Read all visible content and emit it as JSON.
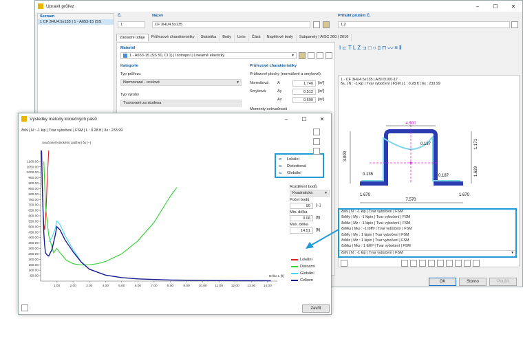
{
  "main_window": {
    "title": "Upravit průřez",
    "controls": [
      "–",
      "☐",
      "✕"
    ]
  },
  "list": {
    "header": "Seznam",
    "item": "1  CF 3HU4.5x135 | 1 - A653-15 (SS"
  },
  "fields": {
    "no_label": "Č.",
    "no_value": "1",
    "name_label": "Název",
    "name_value": "CF 3HU4.5x135",
    "assign_label": "Přiřadit prutům Č.",
    "assign_value": "1,2"
  },
  "tabs": [
    "Základní údaje",
    "Průřezové charakteristiky",
    "Statistika",
    "Body",
    "Linie",
    "Části",
    "Napěťové body",
    "Subpanely | AISC 360 | 2016"
  ],
  "material": {
    "label": "Materiál",
    "value": "1 - A653-15 (SS 50, Cl 1) | Izotropní | Lineárně elastický"
  },
  "category": {
    "label": "Kategorie",
    "type_label": "Typ průřezu",
    "type_value": "Normované - ocelové",
    "manuf_label": "Typ výroby",
    "manuf_value": "Tvarované za studena"
  },
  "props": {
    "label": "Průřezové charakteristiky",
    "subtitle": "Průřezové plochy (normálové a smykové)",
    "rows": [
      {
        "name": "Normálová",
        "sym": "A",
        "val": "1.740",
        "unit": "[in²]"
      },
      {
        "name": "Smyková",
        "sym": "Ay",
        "val": "0.512",
        "unit": "[in²]"
      },
      {
        "name": "",
        "sym": "Az",
        "val": "0.609",
        "unit": "[in²]"
      }
    ],
    "more": "Momenty setrvačnosti"
  },
  "preview": {
    "line1": "1 - CF 3HU4.5x135 | AISI D100-17",
    "line2": "δs,  | N : -1 kip | Tvar vybočení | FSM | L : 0.28 ft | δs : 233.99",
    "dims": {
      "top": "4.500",
      "height": "3.000",
      "right1": "1.171",
      "right2": "1.629",
      "lflange": "1.670",
      "rflange": "1.670",
      "bottom": "7.570",
      "d1": "0.137",
      "d2": "0.135",
      "d3": "0.187"
    }
  },
  "cases": {
    "items": [
      "δsN | N : -1 kip | Tvar vybočení | FSM",
      "δsMy | My : -1 kipin | Tvar vybočení | FSM",
      "δsMz | Mz : -1 kipin | Tvar vybočení | FSM",
      "δsMω | Mω : -1 lbfft² | Tvar vybočení | FSM",
      "δsMy | My : 1 kipin | Tvar vybočení | FSM",
      "δsMz | Mz : 1 kipin | Tvar vybočení | FSM",
      "δsMω | Mω : 1 lbfft² | Tvar vybočení | FSM"
    ],
    "selected": "δsN | N : -1 kip | Tvar vybočení | FSM"
  },
  "main_buttons": {
    "ok": "OK",
    "cancel": "Storno",
    "apply": "Použít"
  },
  "result_window": {
    "title": "Výsledky metody konečných pásů",
    "info": "δsN | N : -1 kip | Tvar vybočení | FSM | L : 0.28 ft | δs : 233.99",
    "close": "Zavřít"
  },
  "mode_legend": [
    "Lokální",
    "Distortional",
    "Globální"
  ],
  "settings": {
    "dist_label": "Rozdělení bodů",
    "dist_value": "Kvadratická",
    "count_label": "Počet bodů",
    "count_value": "50",
    "count_unit": "[--]",
    "min_label": "Min. délka",
    "min_value": "0.06",
    "min_unit": "[ft]",
    "max_label": "Max. délka",
    "max_value": "14.51",
    "max_unit": "[ft]"
  },
  "curve_legend": [
    {
      "name": "Lokální",
      "color": "#e02020"
    },
    {
      "name": "Distorzní",
      "color": "#30d030"
    },
    {
      "name": "Globální",
      "color": "#40d8f0"
    },
    {
      "name": "Celkem",
      "color": "#1a1a90"
    }
  ],
  "chart_data": {
    "type": "line",
    "ylabel": "Součinitel kritického zatížení δs [--]",
    "xlabel": "Délka L [ft]",
    "xlim": [
      0,
      14.6
    ],
    "ylim": [
      0,
      1200
    ],
    "xticks": [
      "1.00",
      "2.00",
      "3.00",
      "4.00",
      "5.00",
      "6.00",
      "7.00",
      "8.00",
      "9.00",
      "10.00",
      "11.00",
      "12.00",
      "13.00",
      "14.00"
    ],
    "yticks": [
      "50.00",
      "100.00",
      "150.00",
      "200.00",
      "250.00",
      "300.00",
      "350.00",
      "400.00",
      "450.00",
      "500.00",
      "550.00",
      "600.00",
      "650.00",
      "700.00",
      "750.00",
      "800.00",
      "850.00",
      "900.00",
      "950.00",
      "1000.00",
      "1050.00",
      "1100.00"
    ],
    "series": [
      {
        "name": "Lokální",
        "x": [
          0.06,
          0.1,
          0.15,
          0.2,
          0.25,
          0.3,
          0.35,
          0.4,
          0.5
        ],
        "y": [
          1200,
          900,
          650,
          520,
          470,
          560,
          700,
          900,
          1200
        ]
      },
      {
        "name": "Distorzní",
        "x": [
          0.2,
          0.3,
          0.5,
          0.8,
          1.0,
          1.2,
          1.6,
          2.0,
          2.5,
          3.0,
          3.5,
          4.0,
          5.0,
          6.0,
          7.0,
          8.0,
          8.4
        ],
        "y": [
          1100,
          700,
          420,
          260,
          300,
          260,
          190,
          160,
          148,
          150,
          160,
          180,
          250,
          370,
          540,
          780,
          860
        ]
      },
      {
        "name": "Globální",
        "x": [
          0.5,
          0.7,
          0.9,
          1.0,
          1.2,
          1.5,
          2.0,
          2.5,
          3.0,
          4.0,
          5.0,
          6.0,
          8.0,
          10.0,
          12.0,
          14.2
        ],
        "y": [
          360,
          400,
          480,
          550,
          520,
          420,
          290,
          180,
          110,
          55,
          32,
          20,
          10,
          6,
          4,
          3
        ]
      },
      {
        "name": "Celkem",
        "x": [
          0.06,
          0.1,
          0.15,
          0.2,
          0.25,
          0.3,
          0.4,
          0.5,
          0.7,
          0.9,
          1.0,
          1.2,
          1.5,
          2.0,
          2.5,
          3.0,
          4.0,
          5.0,
          6.0,
          8.0,
          10.0,
          12.0,
          14.2
        ],
        "y": [
          1200,
          900,
          650,
          440,
          330,
          260,
          240,
          230,
          290,
          420,
          500,
          470,
          380,
          270,
          175,
          110,
          55,
          32,
          20,
          10,
          6,
          4,
          3
        ]
      }
    ]
  }
}
